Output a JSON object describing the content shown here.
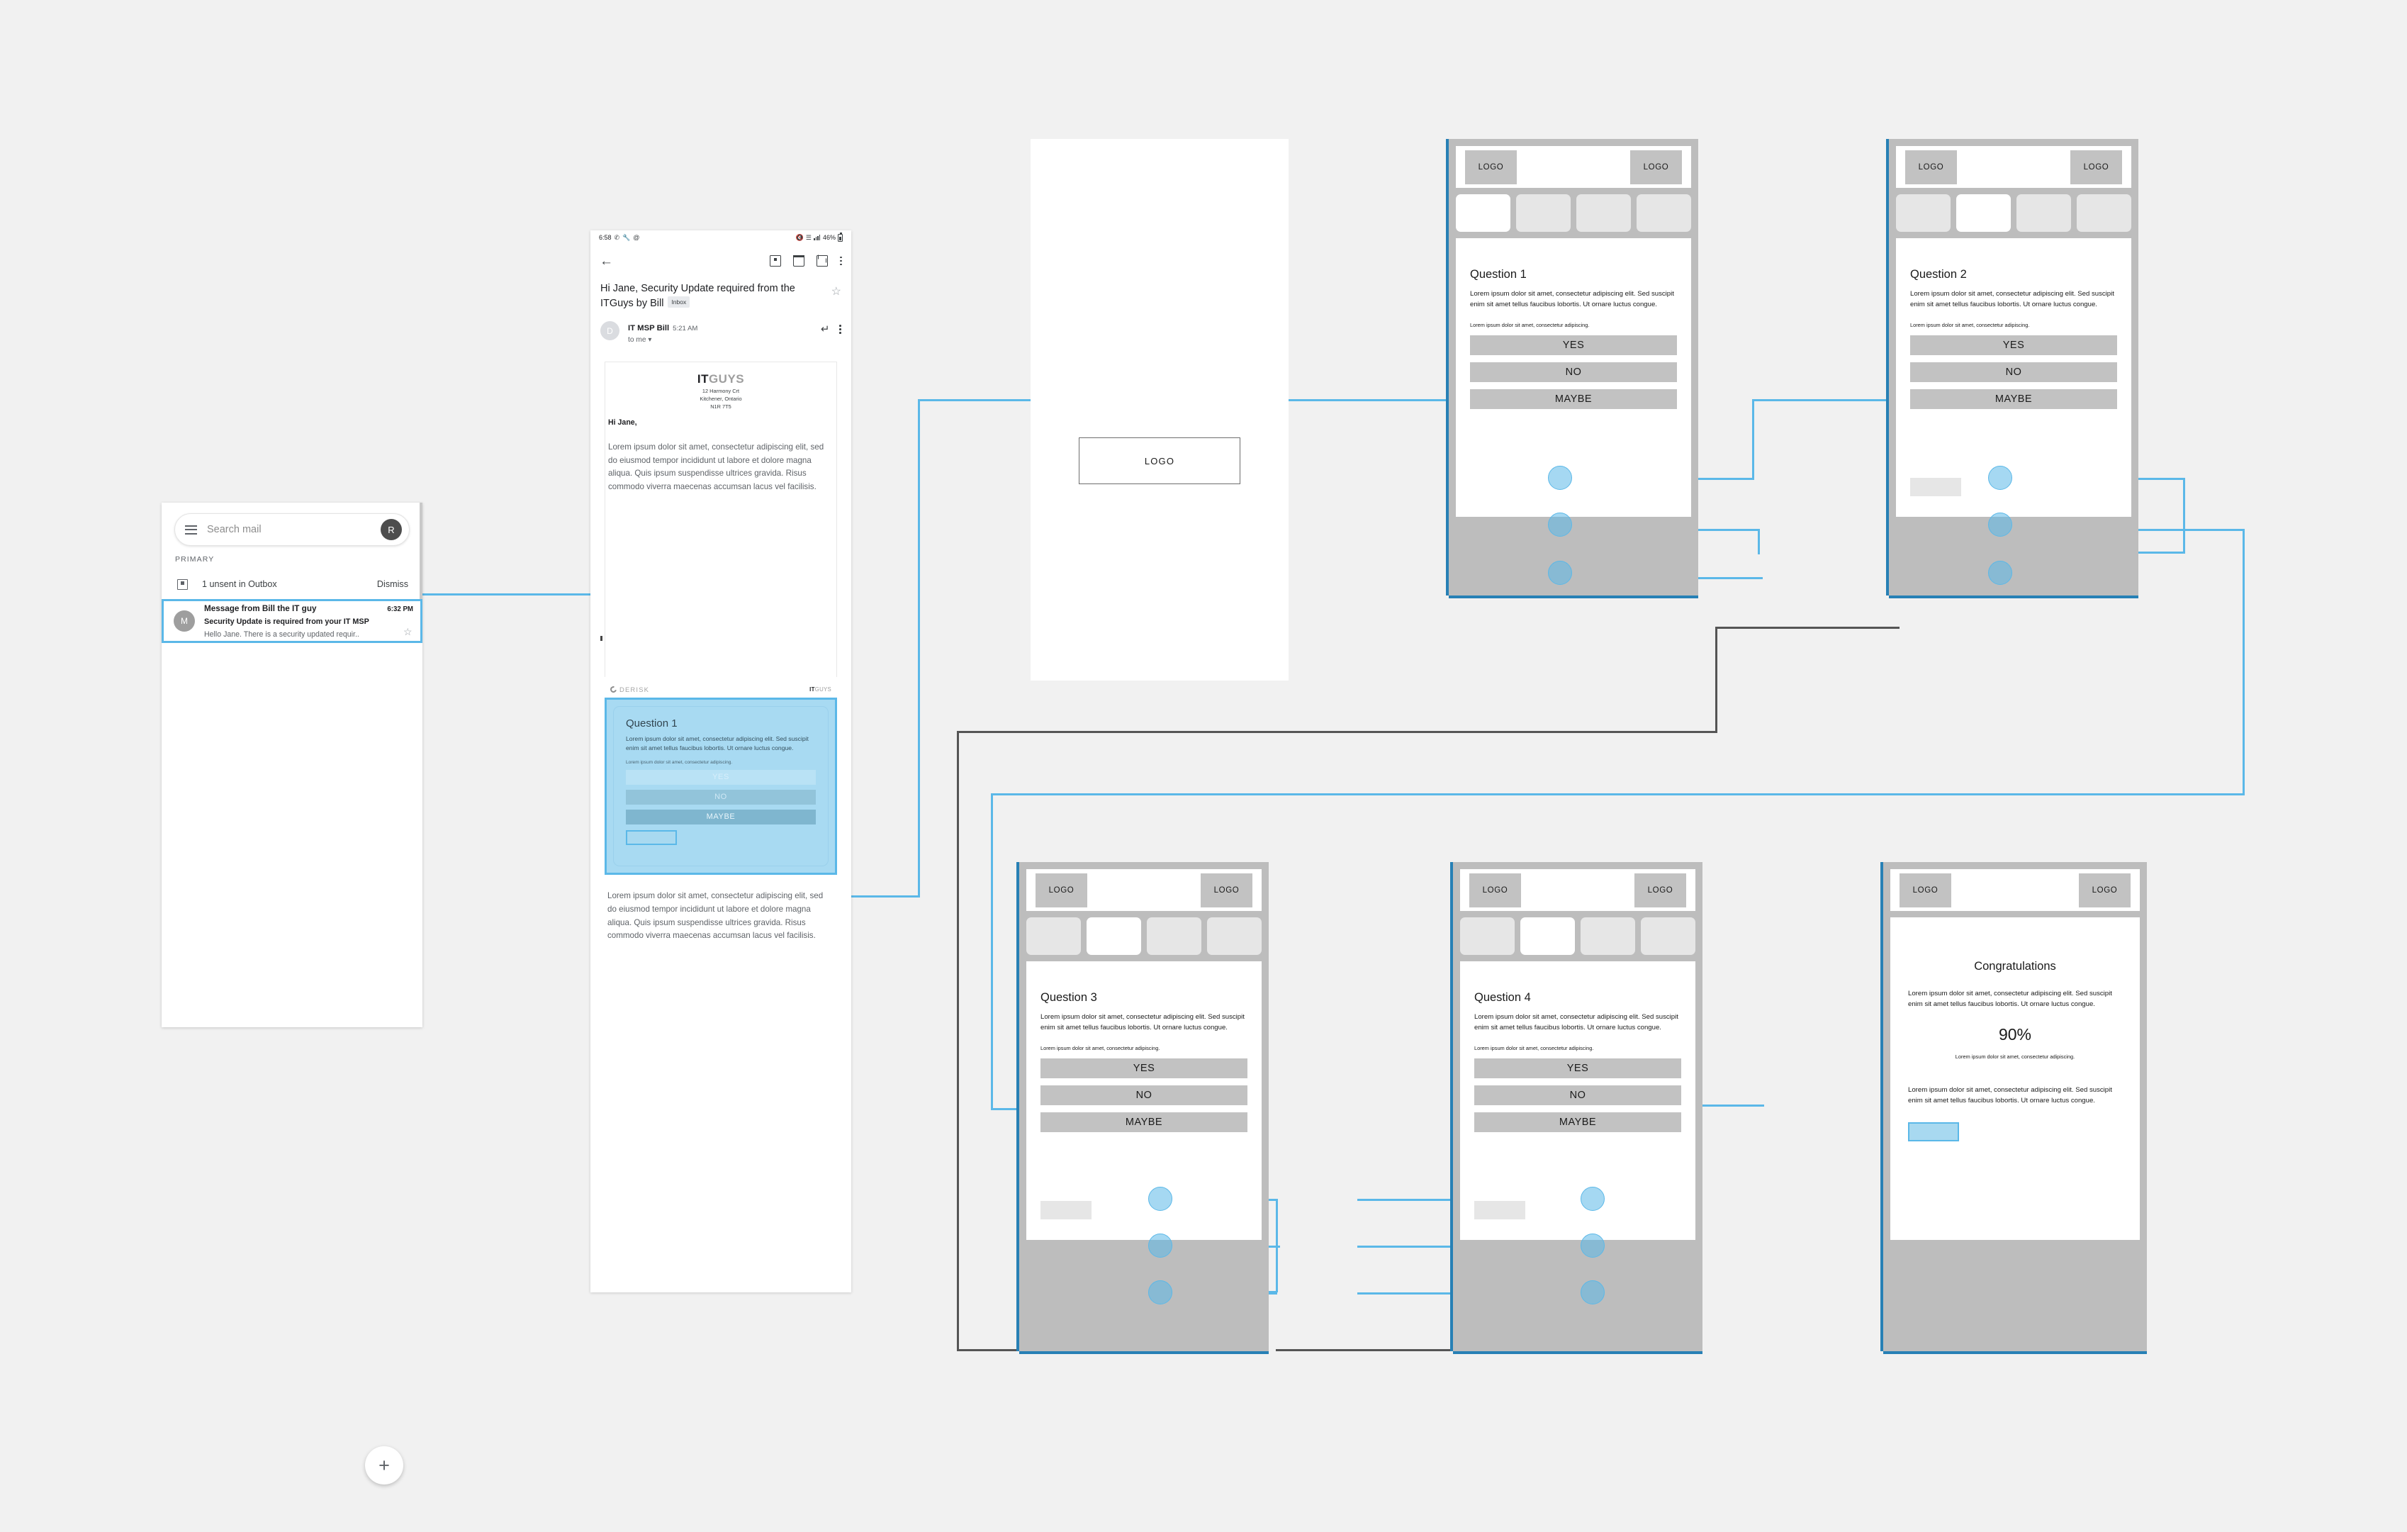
{
  "colors": {
    "accent": "#5bb8e8",
    "panel_chrome": "#bdbdbd",
    "tab_inactive": "#e6e6e6",
    "button_grey": "#c2c2c2",
    "underline_blue": "#2780b5",
    "canvas_bg": "#f1f1f1"
  },
  "inbox": {
    "search": {
      "placeholder": "Search mail",
      "avatar_initial": "R"
    },
    "category_label": "PRIMARY",
    "outbox": {
      "text": "1 unsent in Outbox",
      "dismiss_label": "Dismiss"
    },
    "selected_mail": {
      "avatar_initial": "M",
      "sender": "Message from Bill the IT guy",
      "subject": "Security Update is required from your IT MSP",
      "snippet": "Hello Jane.  There is a security updated requir..",
      "time": "6:32 PM"
    },
    "compose_label": "+"
  },
  "email_detail": {
    "statusbar": {
      "time": "6:58",
      "battery": "46%"
    },
    "subject": "Hi Jane, Security Update required from the ITGuys by Bill",
    "label_chip": "Inbox",
    "sender": {
      "avatar_initial": "D",
      "name": "IT MSP Bill",
      "time": "5:21 AM",
      "recipient": "to me"
    },
    "letterhead": {
      "logo_bold": "IT",
      "logo_light": "GUYS",
      "address_line1": "12 Harmony Crt",
      "address_line2": "Kitchener, Ontario",
      "address_line3": "N1R 7T5"
    },
    "greeting": "Hi Jane,",
    "body": "Lorem ipsum dolor sit amet, consectetur adipiscing elit, sed do eiusmod tempor incididunt ut labore et dolore magna aliqua. Quis ipsum suspendisse ultrices gravida. Risus commodo viverra maecenas accumsan lacus vel facilisis.",
    "embedded_card": {
      "brand": "DERISK",
      "cobrand_bold": "IT",
      "cobrand_light": "GUYS",
      "title": "Question 1",
      "text": "Lorem ipsum dolor sit amet, consectetur adipiscing elit. Sed suscipit enim sit amet tellus faucibus lobortis. Ut ornare luctus congue.",
      "sub": "Lorem ipsum dolor sit amet, consectetur adipiscing.",
      "answers": [
        "YES",
        "NO",
        "MAYBE"
      ]
    },
    "footer_body": "Lorem ipsum dolor sit amet, consectetur adipiscing elit, sed do eiusmod tempor incididunt ut labore et dolore magna aliqua. Quis ipsum suspendisse ultrices gravida. Risus commodo viverra maecenas accumsan lacus vel facilisis."
  },
  "splash": {
    "logo_label": "LOGO"
  },
  "panels": [
    {
      "id": "q1",
      "logo_left": "LOGO",
      "logo_right": "LOGO",
      "active_tab": 0,
      "title": "Question 1",
      "text": "Lorem ipsum dolor sit amet, consectetur adipiscing elit. Sed suscipit enim sit amet tellus faucibus lobortis. Ut ornare luctus congue.",
      "sub": "Lorem ipsum dolor sit amet, consectetur adipiscing.",
      "answers": [
        "YES",
        "NO",
        "MAYBE"
      ],
      "has_back": false
    },
    {
      "id": "q2",
      "logo_left": "LOGO",
      "logo_right": "LOGO",
      "active_tab": 1,
      "title": "Question 2",
      "text": "Lorem ipsum dolor sit amet, consectetur adipiscing elit. Sed suscipit enim sit amet tellus faucibus lobortis. Ut ornare luctus congue.",
      "sub": "Lorem ipsum dolor sit amet, consectetur adipiscing.",
      "answers": [
        "YES",
        "NO",
        "MAYBE"
      ],
      "has_back": true
    },
    {
      "id": "q3",
      "logo_left": "LOGO",
      "logo_right": "LOGO",
      "active_tab": 1,
      "title": "Question 3",
      "text": "Lorem ipsum dolor sit amet, consectetur adipiscing elit. Sed suscipit enim sit amet tellus faucibus lobortis. Ut ornare luctus congue.",
      "sub": "Lorem ipsum dolor sit amet, consectetur adipiscing.",
      "answers": [
        "YES",
        "NO",
        "MAYBE"
      ],
      "has_back": true
    },
    {
      "id": "q4",
      "logo_left": "LOGO",
      "logo_right": "LOGO",
      "active_tab": 1,
      "title": "Question 4",
      "text": "Lorem ipsum dolor sit amet, consectetur adipiscing elit. Sed suscipit enim sit amet tellus faucibus lobortis. Ut ornare luctus congue.",
      "sub": "Lorem ipsum dolor sit amet, consectetur adipiscing.",
      "answers": [
        "YES",
        "NO",
        "MAYBE"
      ],
      "has_back": true
    }
  ],
  "result_panel": {
    "id": "congrats",
    "logo_left": "LOGO",
    "logo_right": "LOGO",
    "title": "Congratulations",
    "text": "Lorem ipsum dolor sit amet, consectetur adipiscing elit. Sed suscipit enim sit amet tellus faucibus lobortis. Ut ornare luctus congue.",
    "percent": "90%",
    "sub": "Lorem ipsum dolor sit amet, consectetur adipiscing.",
    "text2": "Lorem ipsum dolor sit amet, consectetur adipiscing elit. Sed suscipit enim sit amet tellus faucibus lobortis. Ut ornare luctus congue."
  }
}
